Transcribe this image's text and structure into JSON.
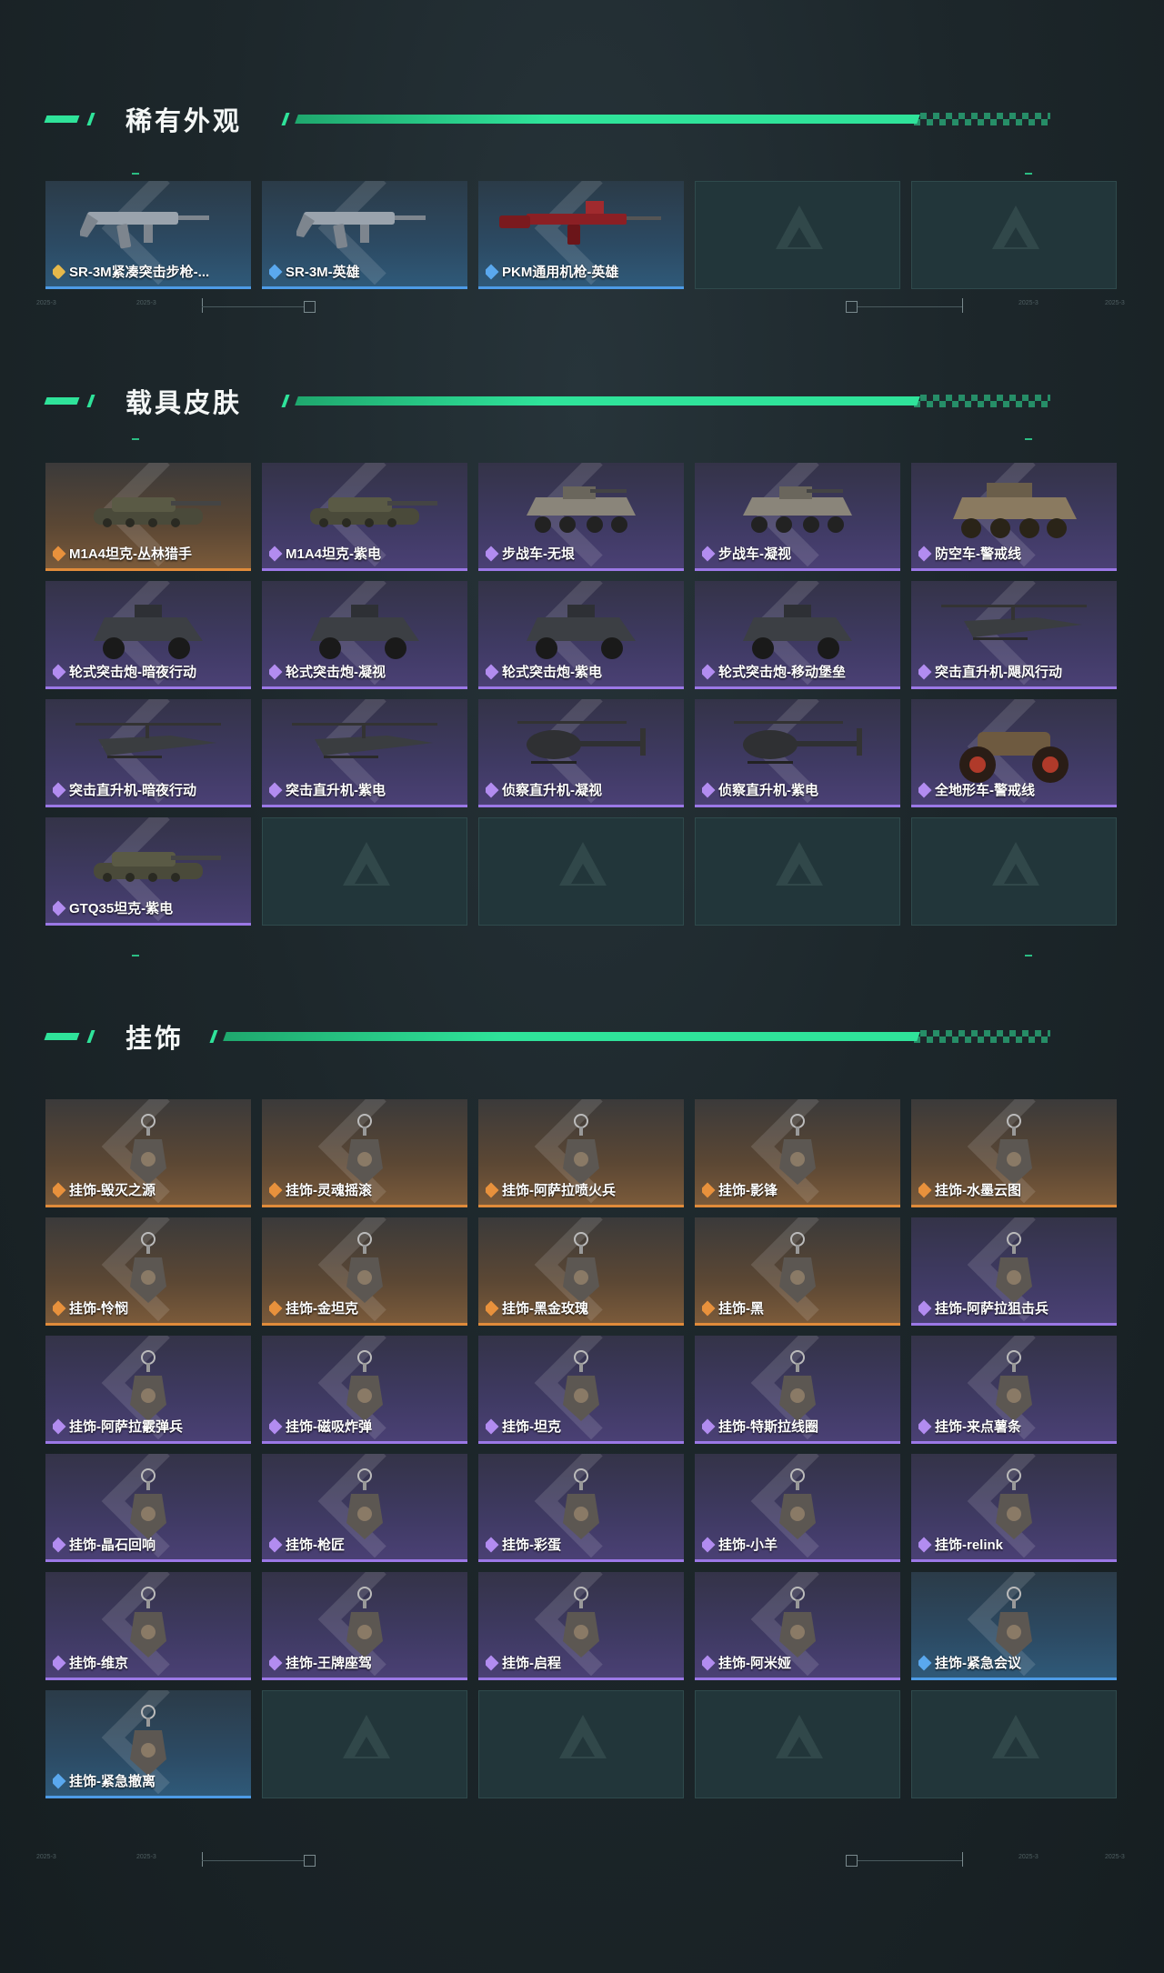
{
  "sections": [
    {
      "title": "稀有外观",
      "items": [
        {
          "label": "SR-3M紧凑突击步枪-...",
          "rarity": "blue",
          "icon": "rifle-icon",
          "special": "gold"
        },
        {
          "label": "SR-3M-英雄",
          "rarity": "blue",
          "icon": "rifle-icon"
        },
        {
          "label": "PKM通用机枪-英雄",
          "rarity": "blue",
          "icon": "machine-gun-icon"
        },
        {
          "label": "",
          "rarity": "empty"
        },
        {
          "label": "",
          "rarity": "empty"
        }
      ]
    },
    {
      "title": "载具皮肤",
      "items": [
        {
          "label": "M1A4坦克-丛林猎手",
          "rarity": "orange",
          "icon": "tank-icon"
        },
        {
          "label": "M1A4坦克-紫电",
          "rarity": "purple",
          "icon": "tank-icon"
        },
        {
          "label": "步战车-无垠",
          "rarity": "purple",
          "icon": "ifv-icon"
        },
        {
          "label": "步战车-凝视",
          "rarity": "purple",
          "icon": "ifv-icon"
        },
        {
          "label": "防空车-警戒线",
          "rarity": "purple",
          "icon": "aa-vehicle-icon"
        },
        {
          "label": "轮式突击炮-暗夜行动",
          "rarity": "purple",
          "icon": "armored-car-icon"
        },
        {
          "label": "轮式突击炮-凝视",
          "rarity": "purple",
          "icon": "armored-car-icon"
        },
        {
          "label": "轮式突击炮-紫电",
          "rarity": "purple",
          "icon": "armored-car-icon"
        },
        {
          "label": "轮式突击炮-移动堡垒",
          "rarity": "purple",
          "icon": "armored-car-icon"
        },
        {
          "label": "突击直升机-飓风行动",
          "rarity": "purple",
          "icon": "helicopter-icon"
        },
        {
          "label": "突击直升机-暗夜行动",
          "rarity": "purple",
          "icon": "helicopter-icon"
        },
        {
          "label": "突击直升机-紫电",
          "rarity": "purple",
          "icon": "helicopter-icon"
        },
        {
          "label": "侦察直升机-凝视",
          "rarity": "purple",
          "icon": "scout-helicopter-icon"
        },
        {
          "label": "侦察直升机-紫电",
          "rarity": "purple",
          "icon": "scout-helicopter-icon"
        },
        {
          "label": "全地形车-警戒线",
          "rarity": "purple",
          "icon": "atv-icon"
        },
        {
          "label": "GTQ35坦克-紫电",
          "rarity": "purple",
          "icon": "tank-icon"
        },
        {
          "label": "",
          "rarity": "empty"
        },
        {
          "label": "",
          "rarity": "empty"
        },
        {
          "label": "",
          "rarity": "empty"
        },
        {
          "label": "",
          "rarity": "empty"
        }
      ]
    },
    {
      "title": "挂饰",
      "items": [
        {
          "label": "挂饰-毁灭之源",
          "rarity": "orange",
          "icon": "charm-icon"
        },
        {
          "label": "挂饰-灵魂摇滚",
          "rarity": "orange",
          "icon": "charm-icon"
        },
        {
          "label": "挂饰-阿萨拉喷火兵",
          "rarity": "orange",
          "icon": "charm-icon"
        },
        {
          "label": "挂饰-影锋",
          "rarity": "orange",
          "icon": "charm-icon"
        },
        {
          "label": "挂饰-水墨云图",
          "rarity": "orange",
          "icon": "charm-icon"
        },
        {
          "label": "挂饰-怜悯",
          "rarity": "orange",
          "icon": "charm-icon"
        },
        {
          "label": "挂饰-金坦克",
          "rarity": "orange",
          "icon": "charm-icon"
        },
        {
          "label": "挂饰-黑金玫瑰",
          "rarity": "orange",
          "icon": "charm-icon"
        },
        {
          "label": "挂饰-黑",
          "rarity": "orange",
          "icon": "charm-icon"
        },
        {
          "label": "挂饰-阿萨拉狙击兵",
          "rarity": "purple",
          "icon": "charm-icon"
        },
        {
          "label": "挂饰-阿萨拉霰弹兵",
          "rarity": "purple",
          "icon": "charm-icon"
        },
        {
          "label": "挂饰-磁吸炸弹",
          "rarity": "purple",
          "icon": "charm-icon"
        },
        {
          "label": "挂饰-坦克",
          "rarity": "purple",
          "icon": "charm-icon"
        },
        {
          "label": "挂饰-特斯拉线圈",
          "rarity": "purple",
          "icon": "charm-icon"
        },
        {
          "label": "挂饰-来点薯条",
          "rarity": "purple",
          "icon": "charm-icon"
        },
        {
          "label": "挂饰-晶石回响",
          "rarity": "purple",
          "icon": "charm-icon"
        },
        {
          "label": "挂饰-枪匠",
          "rarity": "purple",
          "icon": "charm-icon"
        },
        {
          "label": "挂饰-彩蛋",
          "rarity": "purple",
          "icon": "charm-icon"
        },
        {
          "label": "挂饰-小羊",
          "rarity": "purple",
          "icon": "charm-icon"
        },
        {
          "label": "挂饰-relink",
          "rarity": "purple",
          "icon": "charm-icon"
        },
        {
          "label": "挂饰-维京",
          "rarity": "purple",
          "icon": "charm-icon"
        },
        {
          "label": "挂饰-王牌座驾",
          "rarity": "purple",
          "icon": "charm-icon"
        },
        {
          "label": "挂饰-启程",
          "rarity": "purple",
          "icon": "charm-icon"
        },
        {
          "label": "挂饰-阿米娅",
          "rarity": "purple",
          "icon": "charm-icon"
        },
        {
          "label": "挂饰-紧急会议",
          "rarity": "blue",
          "icon": "charm-icon"
        },
        {
          "label": "挂饰-紧急撤离",
          "rarity": "blue",
          "icon": "charm-icon"
        },
        {
          "label": "",
          "rarity": "empty"
        },
        {
          "label": "",
          "rarity": "empty"
        },
        {
          "label": "",
          "rarity": "empty"
        },
        {
          "label": "",
          "rarity": "empty"
        }
      ]
    }
  ],
  "colors": {
    "accent": "#2fe39a",
    "orange": "#e08b3a",
    "purple": "#9b78e6",
    "blue": "#4d9be6"
  }
}
